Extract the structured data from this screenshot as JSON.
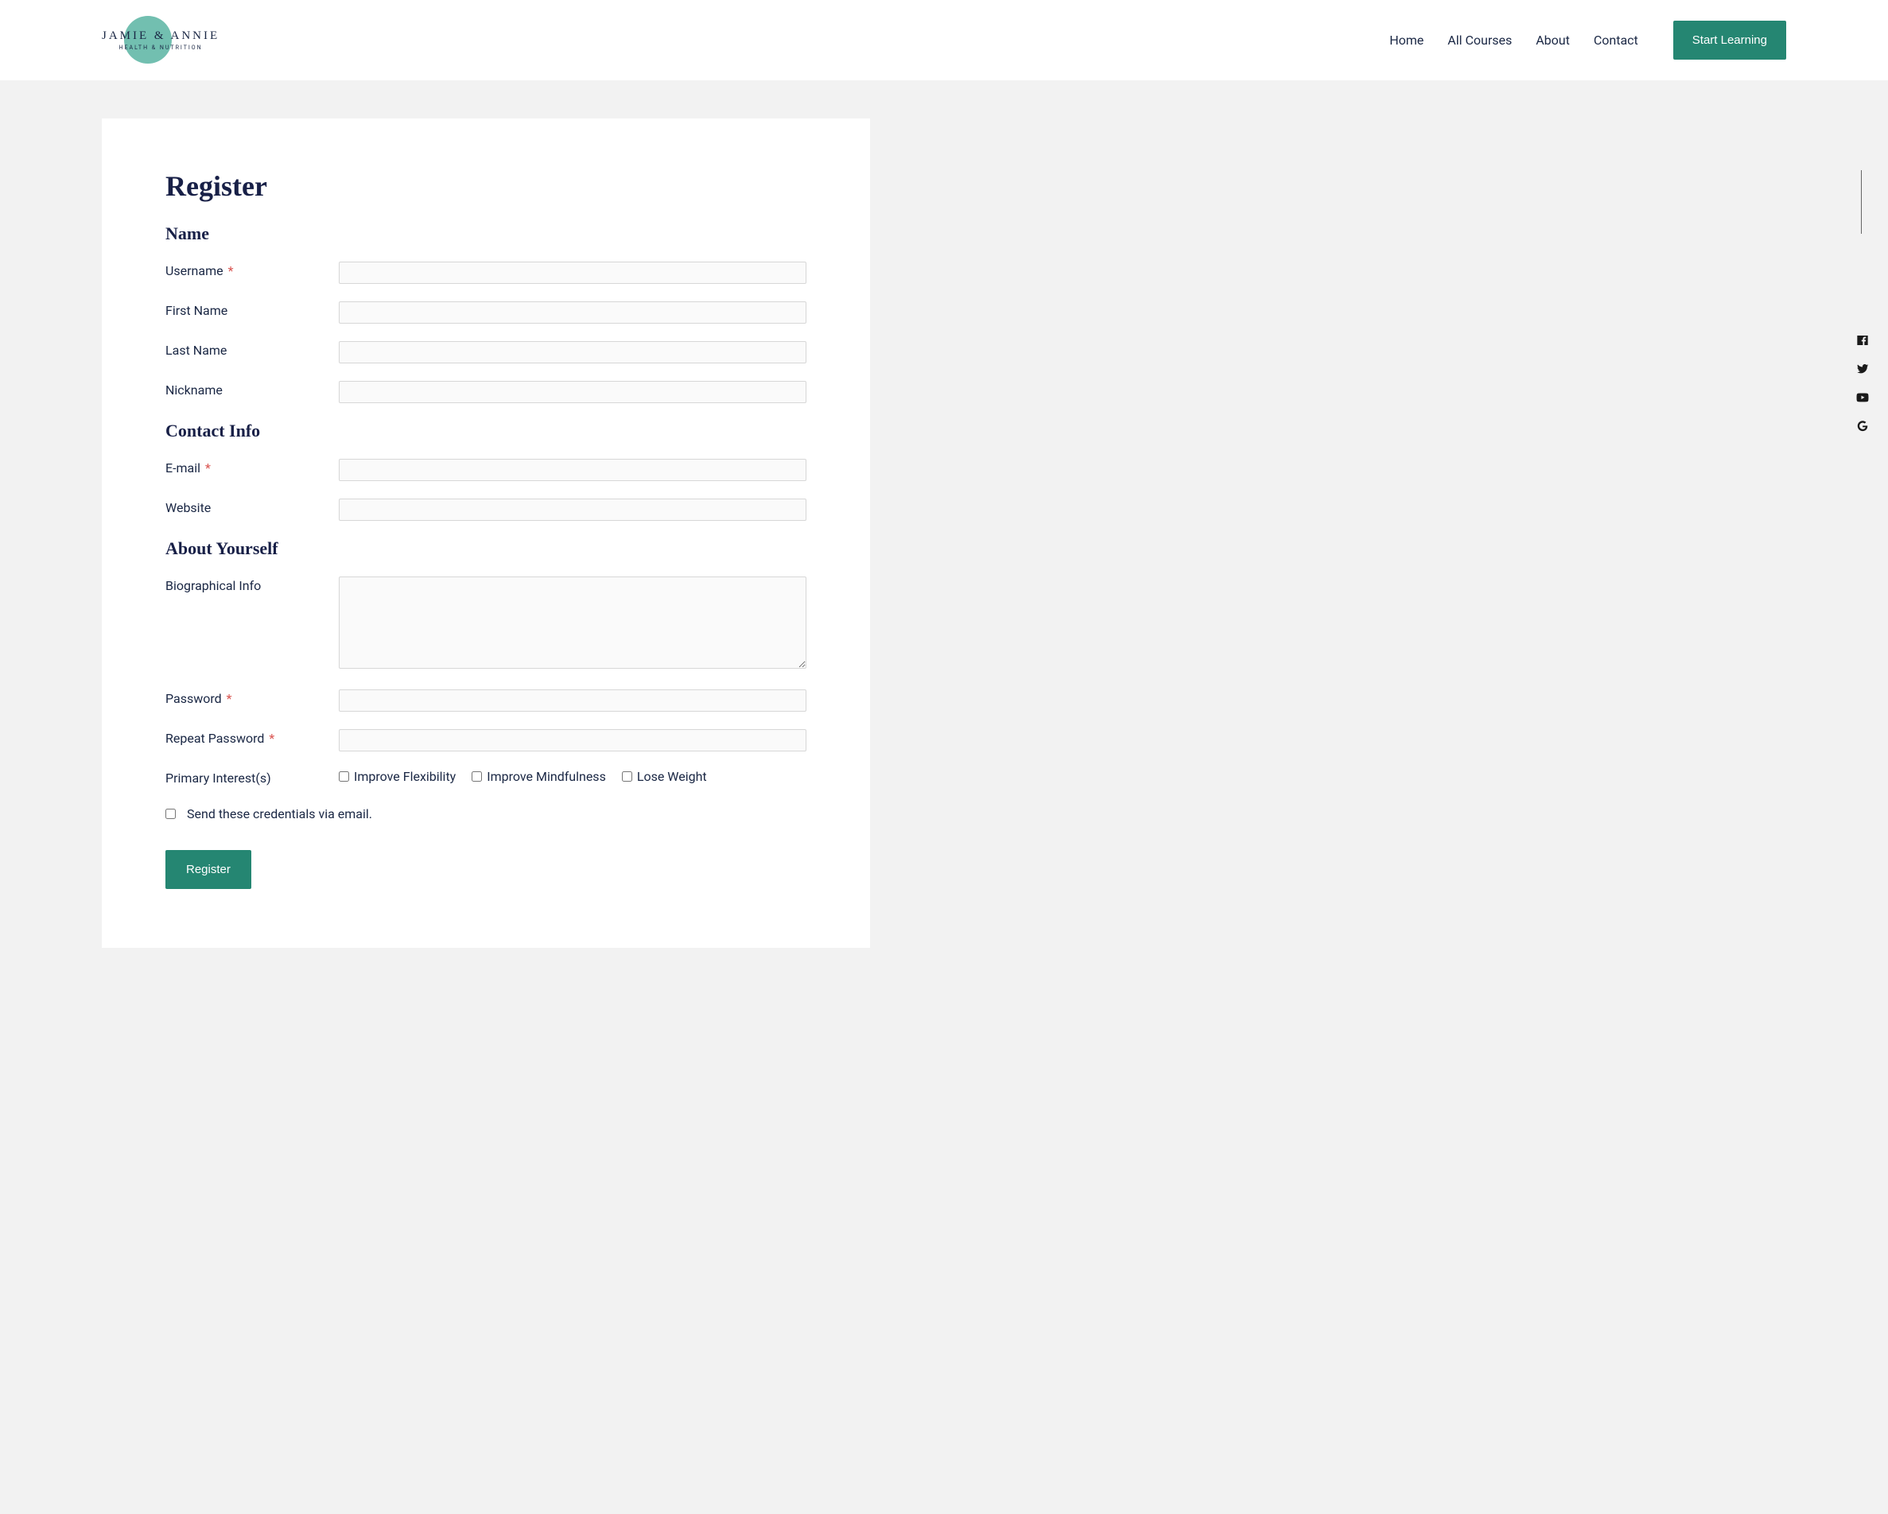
{
  "header": {
    "logo_main": "JAMIE & ANNIE",
    "logo_sub": "HEALTH & NUTRITION",
    "nav": [
      "Home",
      "All Courses",
      "About",
      "Contact"
    ],
    "cta": "Start Learning"
  },
  "page": {
    "title": "Register"
  },
  "sections": {
    "name": {
      "title": "Name",
      "fields": {
        "username": "Username",
        "first_name": "First Name",
        "last_name": "Last Name",
        "nickname": "Nickname"
      }
    },
    "contact": {
      "title": "Contact Info",
      "fields": {
        "email": "E-mail",
        "website": "Website"
      }
    },
    "about": {
      "title": "About Yourself",
      "fields": {
        "bio": "Biographical Info",
        "password": "Password",
        "repeat_password": "Repeat Password",
        "primary_interest": "Primary Interest(s)"
      }
    }
  },
  "interests": {
    "flexibility": "Improve Flexibility",
    "mindfulness": "Improve Mindfulness",
    "lose_weight": "Lose Weight"
  },
  "send_credentials": "Send these credentials via email.",
  "submit": "Register",
  "required_marker": "*"
}
